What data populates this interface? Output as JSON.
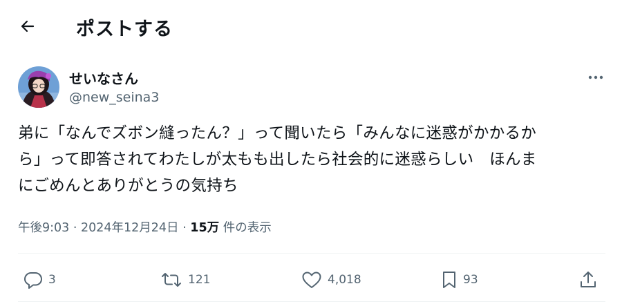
{
  "header": {
    "title": "ポストする"
  },
  "author": {
    "display_name": "せいなさん",
    "handle": "@new_seina3"
  },
  "post": {
    "lines": [
      "弟に「なんでズボン縫ったん？」って聞いたら「みんなに迷惑がかかるか",
      "ら」って即答されてわたしが太もも出したら社会的に迷惑らしい　ほんま",
      "にごめんとありがとうの気持ち"
    ]
  },
  "meta": {
    "timestamp": "午後9:03 · 2024年12月24日 ·",
    "views_count": "15万",
    "views_label": "件の表示"
  },
  "actions": {
    "reply_count": "3",
    "repost_count": "121",
    "like_count": "4,018",
    "bookmark_count": "93"
  },
  "icons": {
    "back": "arrow-left-icon",
    "more": "more-horizontal-icon",
    "reply": "reply-icon",
    "repost": "repost-icon",
    "like": "heart-icon",
    "bookmark": "bookmark-icon",
    "share": "share-icon"
  },
  "colors": {
    "text": "#0f1419",
    "secondary": "#536471",
    "divider": "#eff3f4",
    "background": "#ffffff"
  }
}
